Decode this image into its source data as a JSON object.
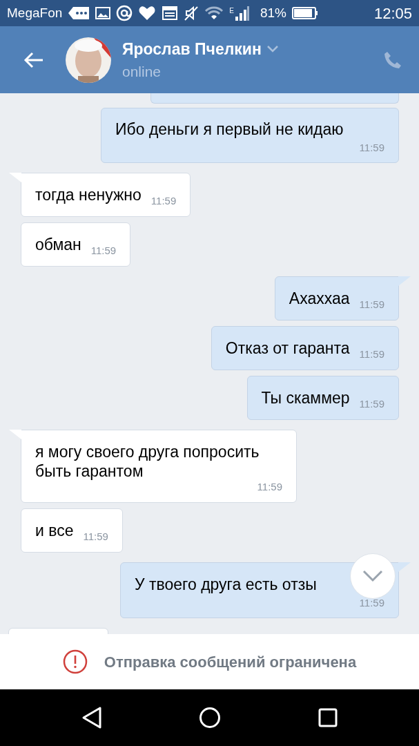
{
  "status_bar": {
    "carrier": "MegaFon",
    "network": "E",
    "battery": "81%",
    "time": "12:05"
  },
  "header": {
    "name": "Ярослав Пчелкин",
    "status": "online"
  },
  "messages": [
    {
      "kind": "outgoing_cut",
      "tail": false
    },
    {
      "kind": "outgoing",
      "text": "Ибо деньги я первый не кидаю",
      "time": "11:59",
      "tail": false
    },
    {
      "kind": "incoming",
      "text": "тогда ненужно",
      "time": "11:59",
      "tail": true
    },
    {
      "kind": "incoming",
      "text": "обман",
      "time": "11:59",
      "tail": false
    },
    {
      "kind": "outgoing",
      "text": "Ахаххаа",
      "time": "11:59",
      "tail": true
    },
    {
      "kind": "outgoing",
      "text": "Отказ от гаранта",
      "time": "11:59",
      "tail": false
    },
    {
      "kind": "outgoing",
      "text": "Ты скаммер",
      "time": "11:59",
      "tail": false
    },
    {
      "kind": "incoming",
      "text": "я могу своего друга попросить быть гарантом",
      "time": "11:59",
      "tail": true
    },
    {
      "kind": "incoming",
      "text": "и все",
      "time": "11:59",
      "tail": false
    },
    {
      "kind": "outgoing",
      "text": "У твоего друга есть отзы",
      "time": "11:59",
      "tail": true
    },
    {
      "kind": "incoming_cut",
      "tail": false
    }
  ],
  "notice": "Отправка сообщений ограничена"
}
